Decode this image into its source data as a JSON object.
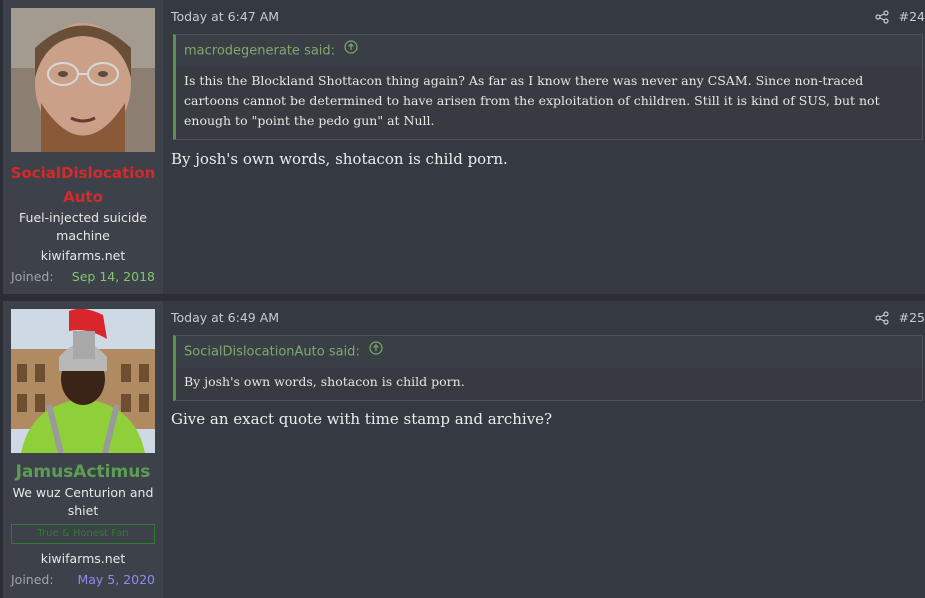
{
  "posts": [
    {
      "username": "SocialDislocationAuto",
      "user_title": "Fuel-injected suicide machine",
      "site": "kiwifarms.net",
      "joined_label": "Joined:",
      "joined_date": "Sep 14, 2018",
      "time": "Today at 6:47 AM",
      "number": "#24",
      "quote_author": "macrodegenerate said:",
      "quote_text": "Is this the Blockland Shottacon thing again? As far as I know there was never any CSAM. Since non-traced cartoons cannot be determined to have arisen from the exploitation of children. Still it is kind of SUS, but not enough to \"point the pedo gun\" at Null.",
      "body": "By josh's own words, shotacon is child porn."
    },
    {
      "username": "JamusActimus",
      "user_title": "We wuz Centurion and shiet",
      "banner": "True & Honest Fan",
      "site": "kiwifarms.net",
      "joined_label": "Joined:",
      "joined_date": "May 5, 2020",
      "time": "Today at 6:49 AM",
      "number": "#25",
      "quote_author": "SocialDislocationAuto said:",
      "quote_text": "By josh's own words, shotacon is child porn.",
      "body": "Give an exact quote with time stamp and archive?"
    }
  ],
  "icons": {
    "share": "share-icon",
    "quote_arrow": "arrow-up-circle-icon"
  },
  "colors": {
    "username_1": "#d42a2a",
    "username_2": "#5b9e55",
    "quote_border": "#5c8f52"
  }
}
